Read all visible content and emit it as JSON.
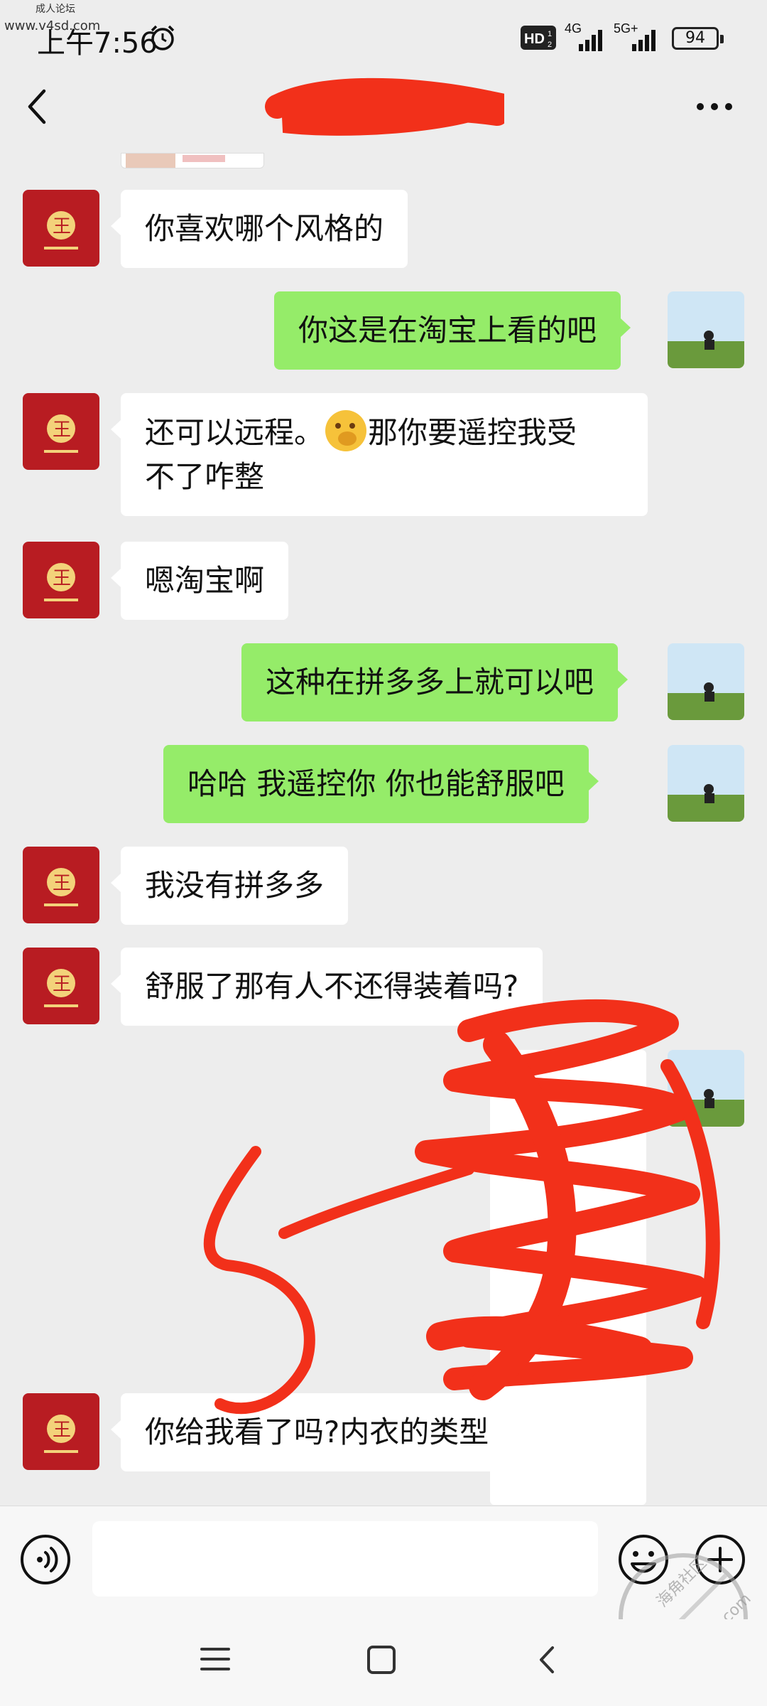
{
  "status_bar": {
    "time": "上午7:56",
    "hd": "HD",
    "signal_1": "4G",
    "signal_2": "5G+",
    "battery": "94",
    "watermark_label": "成人论坛",
    "watermark_url": "www.v4sd.com"
  },
  "header": {
    "back_icon": "chevron-left-icon",
    "more_icon": "more-dots-icon"
  },
  "messages": [
    {
      "side": "left",
      "text": "你喜欢哪个风格的"
    },
    {
      "side": "right",
      "text": "你这是在淘宝上看的吧"
    },
    {
      "side": "left",
      "text_a": "还可以远程。",
      "text_b": "那你要遥控我受",
      "text_c": "不了咋整"
    },
    {
      "side": "left",
      "text": "嗯淘宝啊"
    },
    {
      "side": "right",
      "text": "这种在拼多多上就可以吧"
    },
    {
      "side": "right",
      "text": "哈哈  我遥控你  你也能舒服吧"
    },
    {
      "side": "left",
      "text": "我没有拼多多"
    },
    {
      "side": "left",
      "text": "舒服了那有人不还得装着吗?"
    },
    {
      "side": "left",
      "text": "你给我看了吗?内衣的类型"
    }
  ],
  "avatar_badge": "王",
  "input": {
    "voice_icon": "voice-icon",
    "emoji_icon": "emoji-icon",
    "plus_icon": "plus-icon"
  },
  "nav": {
    "menu_icon": "menu-icon",
    "home_icon": "home-icon",
    "back_icon": "back-icon"
  },
  "corner_watermark": {
    "line1": "海角社区",
    "line2": "haijiao.com"
  },
  "colors": {
    "background": "#ededed",
    "bubble_mine": "#95ec69",
    "bubble_other": "#ffffff",
    "redaction": "#f2301a",
    "avatar_red": "#b81c22"
  }
}
